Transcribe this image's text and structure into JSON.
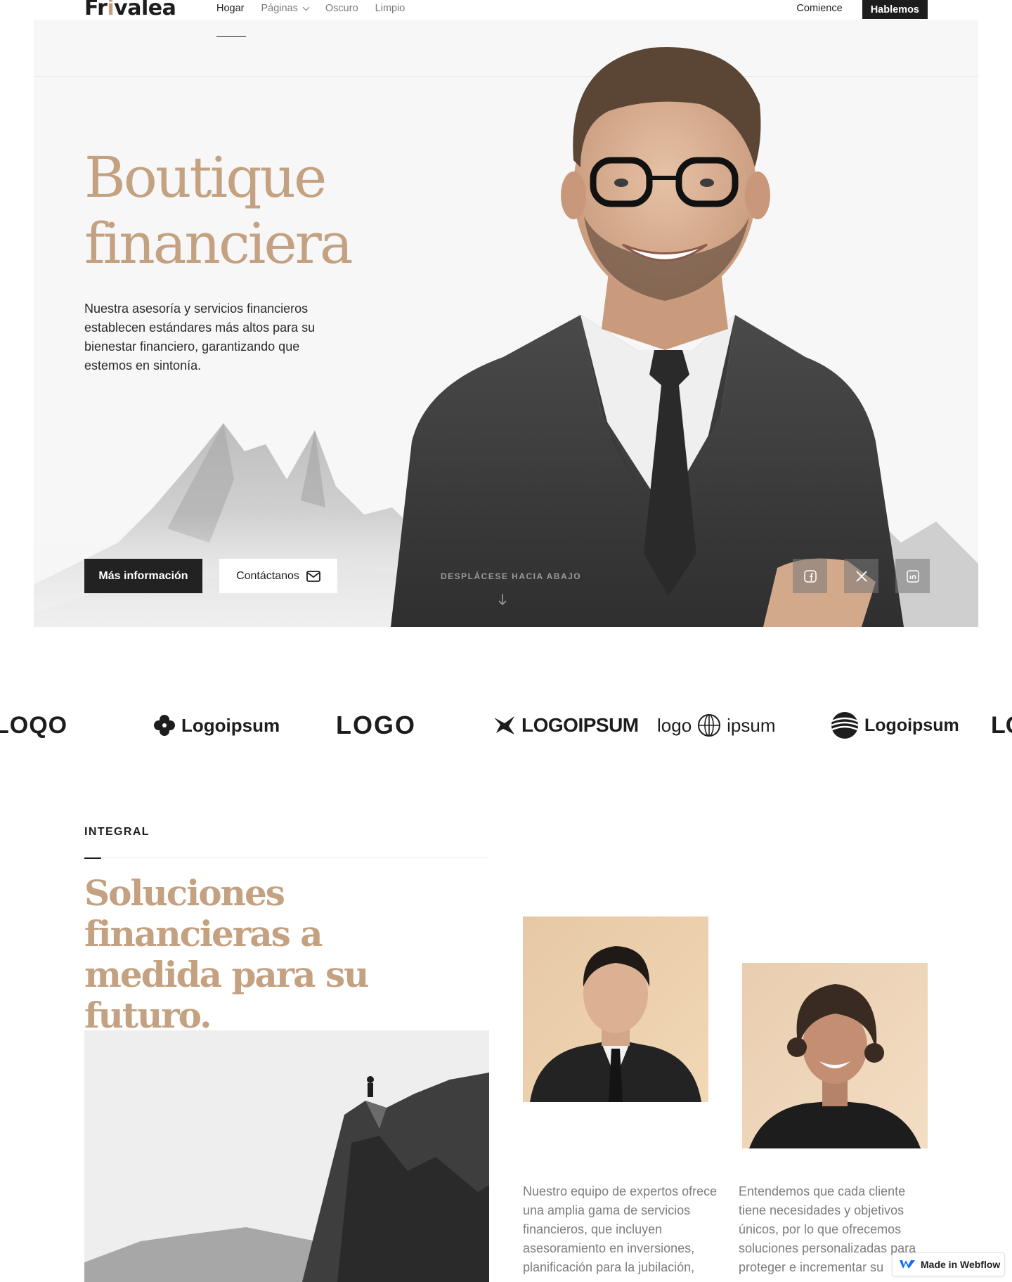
{
  "brand": {
    "name_before": "Fr",
    "name_dot": "i",
    "name_after": "valea"
  },
  "nav": {
    "links": [
      "Hogar",
      "Páginas",
      "Oscuro",
      "Limpio"
    ],
    "start": "Comience",
    "cta": "Hablemos"
  },
  "hero": {
    "title_line1": "Boutique",
    "title_line2": "financiera",
    "text": "Nuestra asesoría y servicios financieros establecen estándares más altos para su bienestar financiero, garantizando que estemos en sintonía.",
    "primary_button": "Más información",
    "secondary_button": "Contáctanos",
    "scroll_label": "DESPLÁCESE HACIA ABAJO"
  },
  "logos": [
    "LOQO",
    "Logoipsum",
    "LOGO",
    "LOGOIPSUM",
    "logo",
    "ipsum",
    "Logoipsum",
    "LO"
  ],
  "section": {
    "eyebrow": "INTEGRAL",
    "title_line1": "Soluciones financieras a",
    "title_line2": "medida para su futuro.",
    "para_a": "Nuestro equipo de expertos ofrece una amplia gama de servicios financieros, que incluyen asesoramiento en inversiones, planificación para la jubilación,",
    "para_b": "Entendemos que cada cliente tiene necesidades y objetivos únicos, por lo que ofrecemos soluciones personalizadas para proteger e incrementar su"
  },
  "badge": {
    "label": "Made in Webflow"
  },
  "colors": {
    "accent": "#c3a181",
    "dark": "#1d1d1d",
    "hero_bg": "#f7f7f7"
  }
}
